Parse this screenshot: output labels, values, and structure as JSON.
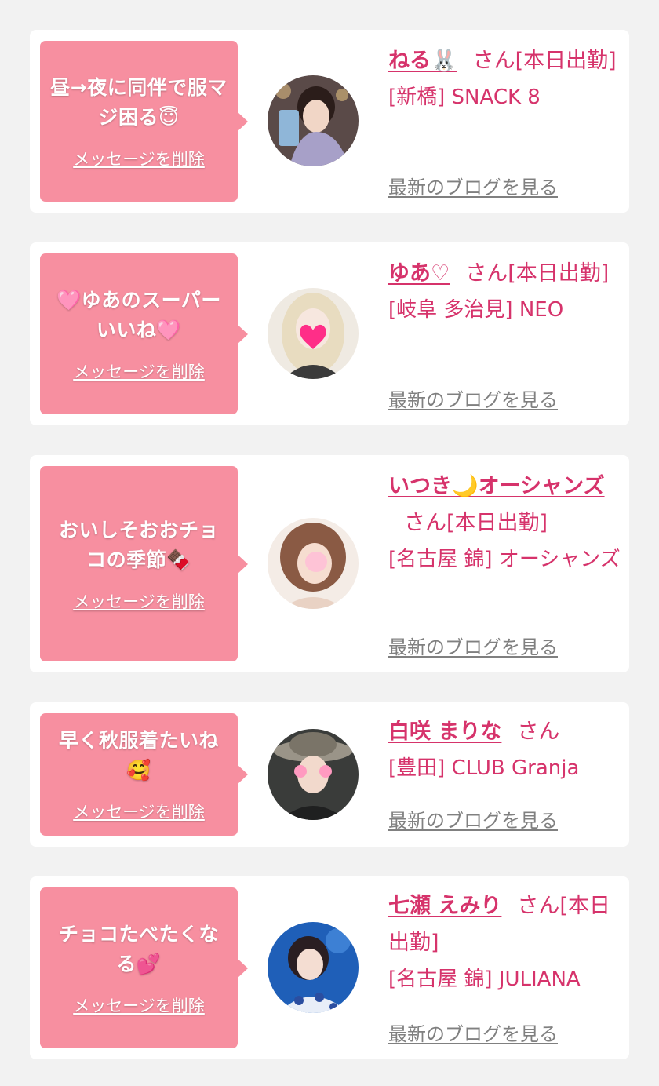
{
  "delete_label": "メッセージを削除",
  "blog_label": "最新のブログを見る",
  "accent_color": "#d6336b",
  "bubble_color": "#f78fa0",
  "cards": [
    {
      "message": "昼→夜に同伴で服マジ困る😇",
      "name": "ねる🐰",
      "suffix": "さん[本日出勤]",
      "shop": "[新橋] SNACK 8"
    },
    {
      "message": "🩷ゆあのスーパーいいね🩷",
      "name": "ゆあ♡",
      "suffix": "さん[本日出勤]",
      "shop": "[岐阜 多治見] NEO"
    },
    {
      "message": "おいしそおおチョコの季節🍫",
      "name": "いつき🌙オーシャンズ",
      "suffix": "さん[本日出勤]",
      "shop": "[名古屋 錦] オーシャンズ"
    },
    {
      "message": "早く秋服着たいね🥰",
      "name": "白咲 まりな",
      "suffix": "さん",
      "shop": "[豊田] CLUB Granja"
    },
    {
      "message": "チョコたべたくなる💕",
      "name": "七瀬 えみり",
      "suffix": "さん[本日出勤]",
      "shop": "[名古屋 錦] JULIANA"
    }
  ]
}
